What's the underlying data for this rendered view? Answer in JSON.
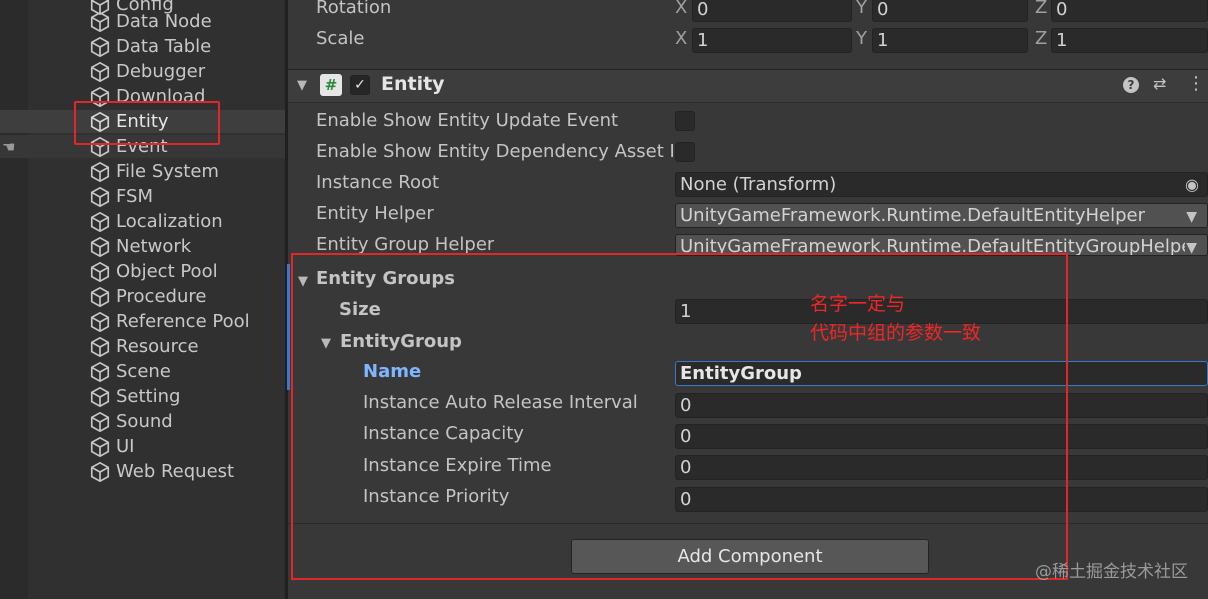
{
  "hierarchy": {
    "items": [
      {
        "label": "Config"
      },
      {
        "label": "Data Node"
      },
      {
        "label": "Data Table"
      },
      {
        "label": "Debugger"
      },
      {
        "label": "Download"
      },
      {
        "label": "Entity"
      },
      {
        "label": "Event"
      },
      {
        "label": "File System"
      },
      {
        "label": "FSM"
      },
      {
        "label": "Localization"
      },
      {
        "label": "Network"
      },
      {
        "label": "Object Pool"
      },
      {
        "label": "Procedure"
      },
      {
        "label": "Reference Pool"
      },
      {
        "label": "Resource"
      },
      {
        "label": "Scene"
      },
      {
        "label": "Setting"
      },
      {
        "label": "Sound"
      },
      {
        "label": "UI"
      },
      {
        "label": "Web Request"
      }
    ],
    "selected": "Entity"
  },
  "transform": {
    "rotation_label": "Rotation",
    "scale_label": "Scale",
    "rotation": {
      "x": "0",
      "y": "0",
      "z": "0"
    },
    "scale": {
      "x": "1",
      "y": "1",
      "z": "1"
    },
    "axis_x": "X",
    "axis_y": "Y",
    "axis_z": "Z"
  },
  "component": {
    "icon": "#",
    "title": "Entity",
    "help_icon": "?",
    "settings_icon": "⇄",
    "menu_icon": "⋮"
  },
  "props": {
    "update_event_label": "Enable Show Entity Update Event",
    "dependency_label": "Enable Show Entity Dependency Asset E",
    "instance_root_label": "Instance Root",
    "instance_root_value": "None (Transform)",
    "entity_helper_label": "Entity Helper",
    "entity_helper_value": "UnityGameFramework.Runtime.DefaultEntityHelper",
    "group_helper_label": "Entity Group Helper",
    "group_helper_value": "UnityGameFramework.Runtime.DefaultEntityGroupHelpe"
  },
  "groups": {
    "title": "Entity Groups",
    "size_label": "Size",
    "size_value": "1",
    "group_title": "EntityGroup",
    "name_label": "Name",
    "name_value": "EntityGroup",
    "auto_release_label": "Instance Auto Release Interval",
    "auto_release_value": "0",
    "capacity_label": "Instance Capacity",
    "capacity_value": "0",
    "expire_label": "Instance Expire Time",
    "expire_value": "0",
    "priority_label": "Instance Priority",
    "priority_value": "0"
  },
  "annotation": {
    "line1": "名字一定与",
    "line2": "代码中组的参数一致",
    "color": "#f02626"
  },
  "add_component_label": "Add Component",
  "watermark": "@稀土掘金技术社区"
}
